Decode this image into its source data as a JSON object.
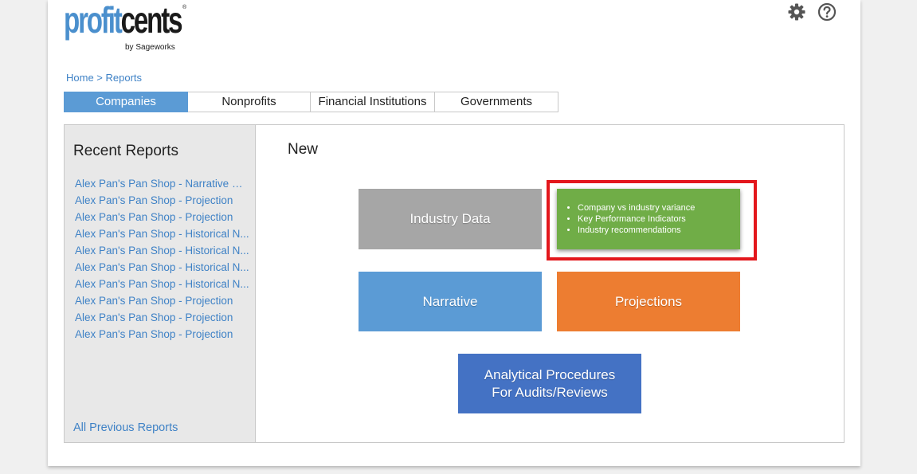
{
  "logo": {
    "word_part1": "profit",
    "word_part2": "cents",
    "registered": "®",
    "byline": "by Sageworks"
  },
  "icons": {
    "settings": "gear-icon",
    "help": "help-icon"
  },
  "breadcrumb": {
    "home": "Home",
    "separator": " > ",
    "current": "Reports"
  },
  "tabs": [
    {
      "label": "Companies",
      "active": true
    },
    {
      "label": "Nonprofits",
      "active": false
    },
    {
      "label": "Financial Institutions",
      "active": false
    },
    {
      "label": "Governments",
      "active": false
    }
  ],
  "sidebar": {
    "title": "Recent Reports",
    "items": [
      "Alex Pan's Pan Shop - Narrative wi...",
      "Alex Pan's Pan Shop - Projection",
      "Alex Pan's Pan Shop - Projection",
      "Alex Pan's Pan Shop - Historical N...",
      "Alex Pan's Pan Shop - Historical N...",
      "Alex Pan's Pan Shop - Historical N...",
      "Alex Pan's Pan Shop - Historical N...",
      "Alex Pan's Pan Shop - Projection",
      "Alex Pan's Pan Shop - Projection",
      "Alex Pan's Pan Shop - Projection"
    ],
    "all_previous": "All Previous Reports"
  },
  "main": {
    "title": "New",
    "tiles": {
      "industry_data": "Industry Data",
      "benchmark_bullets": [
        "Company vs industry variance",
        "Key Performance Indicators",
        "Industry recommendations"
      ],
      "narrative": "Narrative",
      "projections": "Projections",
      "analytical_line1": "Analytical Procedures",
      "analytical_line2": "For Audits/Reviews"
    },
    "colors": {
      "industry_data": "#a6a6a6",
      "benchmark": "#70ad47",
      "narrative": "#5b9bd5",
      "projections": "#ed7d31",
      "analytical": "#4472c4",
      "highlight": "#e3171c",
      "accent": "#5b9bd5",
      "link": "#3f82c6"
    }
  }
}
